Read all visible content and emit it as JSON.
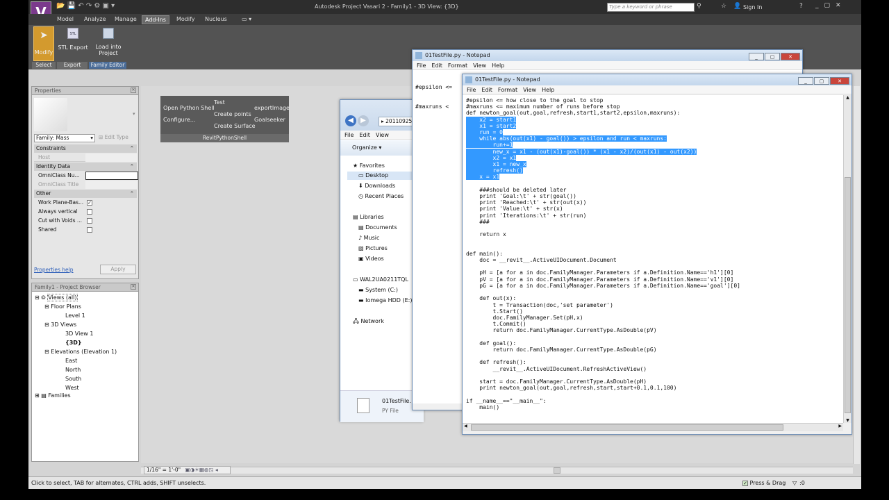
{
  "app": {
    "title": "Autodesk Project Vasari 2 -   Family1 - 3D View: {3D}",
    "search_placeholder": "Type a keyword or phrase",
    "sign_in": "Sign In"
  },
  "ribbon": {
    "tabs": [
      "Model",
      "Analyze",
      "Manage",
      "Add-Ins",
      "Modify",
      "Nucleus"
    ],
    "buttons": {
      "modify": "Modify",
      "stl_export": "STL Export",
      "load_into": "Load into",
      "project": "Project"
    },
    "panels": {
      "select": "Select",
      "export": "Export",
      "family_editor": "Family Editor"
    }
  },
  "properties": {
    "title": "Properties",
    "family": "Family: Mass",
    "edit_type": "Edit Type",
    "constraints": "Constraints",
    "host": "Host",
    "identity": "Identity Data",
    "omni_num": "OmniClass Nu...",
    "omni_title": "OmniClass Title",
    "other": "Other",
    "work_plane": "Work Plane-Bas...",
    "always_vertical": "Always vertical",
    "cut_voids": "Cut with Voids ...",
    "shared": "Shared",
    "help": "Properties help",
    "apply": "Apply"
  },
  "browser": {
    "title": "Family1 - Project Browser",
    "views_all": "Views (all)",
    "floor_plans": "Floor Plans",
    "level1": "Level 1",
    "views3d": "3D Views",
    "view1": "3D View 1",
    "view3d": "{3D}",
    "elevations": "Elevations (Elevation 1)",
    "east": "East",
    "north": "North",
    "south": "South",
    "west": "West",
    "families": "Families"
  },
  "rps": {
    "open": "Open Python Shell",
    "configure": "Configure...",
    "test": "Test",
    "create_points": "Create points",
    "create_surface": "Create Surface",
    "export_image": "exportImage",
    "goalseeker": "Goalseeker",
    "footer": "RevitPythonShell"
  },
  "explorer": {
    "path": "20110925_pySamples",
    "file_menu": [
      "File",
      "Edit",
      "View"
    ],
    "organize": "Organize",
    "nav": [
      "Favorites",
      "Desktop",
      "Downloads",
      "Recent Places",
      "Libraries",
      "Documents",
      "Music",
      "Pictures",
      "Videos",
      "WAL2UA0211TQL",
      "System (C:)",
      "Iomega HDD (E:)",
      "Network"
    ],
    "file_name": "01TestFile.",
    "file_type": "PY File"
  },
  "notepad_back": {
    "title": "01TestFile.py - Notepad",
    "menu": [
      "File",
      "Edit",
      "Format",
      "View",
      "Help"
    ],
    "line1": "#epsilon <=",
    "line2": "#maxruns <"
  },
  "notepad_front": {
    "title": "01TestFile.py - Notepad",
    "menu": [
      "File",
      "Edit",
      "Format",
      "View",
      "Help"
    ]
  },
  "middle_code": [
    "    x2 =",
    "    x1",
    "    refr",
    "  x = x1",
    "",
    "  ###shou",
    "  print '",
    "  print '",
    "  print '",
    "  print '",
    "  ###",
    "",
    "  return",
    "",
    "def main():",
    "  doc = _",
    "",
    "  pH = [a",
    "  pV = [a",
    "  pG = [a",
    "",
    "  def out",
    "    t =",
    "    t.S",
    "    doc",
    "    t.C",
    "    retu",
    "",
    "  def goa",
    "    retu",
    "",
    "  def refr",
    "    __r",
    "",
    "  start =",
    "  print n",
    "",
    "if __name__",
    "  main()"
  ],
  "code": {
    "pre": [
      "#epsilon <= how close to the goal to stop",
      "#maxruns <= maximum number of runs before stop",
      "def newton_goal(out,goal,refresh,start1,start2,epsilon,maxruns):"
    ],
    "sel": [
      "    x2 = start1",
      "    x1 = start2",
      "    run = 0",
      "    while abs(out(x1) - goal()) > epsilon and run < maxruns:",
      "        run+=1",
      "        new_x = x1 - (out(x1)-goal()) * (x1 - x2)/(out(x1) - out(x2))",
      "        x2 = x1",
      "        x1 = new_x",
      "        refresh()",
      "    x = x1"
    ],
    "post": [
      "",
      "    ###should be deleted later",
      "    print 'Goal:\\t' + str(goal())",
      "    print 'Reached:\\t' + str(out(x))",
      "    print 'Value:\\t' + str(x)",
      "    print 'Iterations:\\t' + str(run)",
      "    ###",
      "",
      "    return x",
      "",
      "",
      "def main():",
      "    doc = __revit__.ActiveUIDocument.Document",
      "",
      "    pH = [a for a in doc.FamilyManager.Parameters if a.Definition.Name=='h1'][0]",
      "    pV = [a for a in doc.FamilyManager.Parameters if a.Definition.Name=='v1'][0]",
      "    pG = [a for a in doc.FamilyManager.Parameters if a.Definition.Name=='goal'][0]",
      "",
      "    def out(x):",
      "        t = Transaction(doc,'set parameter')",
      "        t.Start()",
      "        doc.FamilyManager.Set(pH,x)",
      "        t.Commit()",
      "        return doc.FamilyManager.CurrentType.AsDouble(pV)",
      "",
      "    def goal():",
      "        return doc.FamilyManager.CurrentType.AsDouble(pG)",
      "",
      "    def refresh():",
      "        __revit__.ActiveUIDocument.RefreshActiveView()",
      "",
      "    start = doc.FamilyManager.CurrentType.AsDouble(pH)",
      "    print newton_goal(out,goal,refresh,start,start+0.1,0.1,100)",
      "",
      "if __name__==\"__main__\":",
      "    main()"
    ]
  },
  "viewbar": {
    "scale": "1/16\" = 1'-0\""
  },
  "status": {
    "hint": "Click to select, TAB for alternates, CTRL adds, SHIFT unselects.",
    "press_drag": "Press & Drag",
    "filter": ":0"
  },
  "colors": {
    "selection": "#3399ff",
    "ribbon": "#535353"
  }
}
